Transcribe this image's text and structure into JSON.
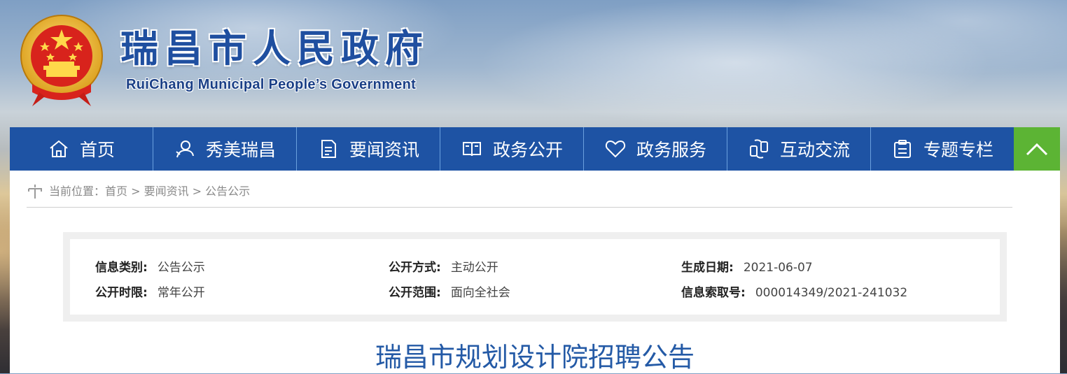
{
  "header": {
    "title": "瑞昌市人民政府",
    "subtitle": "RuiChang Municipal People’s Government"
  },
  "nav": {
    "items": [
      {
        "label": "首页",
        "icon": "home-icon"
      },
      {
        "label": "秀美瑞昌",
        "icon": "person-icon"
      },
      {
        "label": "要闻资讯",
        "icon": "document-icon"
      },
      {
        "label": "政务公开",
        "icon": "book-icon"
      },
      {
        "label": "政务服务",
        "icon": "heart-icon"
      },
      {
        "label": "互动交流",
        "icon": "exchange-icon"
      },
      {
        "label": "专题专栏",
        "icon": "clipboard-icon"
      }
    ],
    "scroll_top_icon": "chevron-up-icon"
  },
  "breadcrumb": {
    "text": "当前位置：首页 > 要闻资讯 > 公告公示"
  },
  "meta": {
    "category_label": "信息类别:",
    "category_value": "公告公示",
    "disclosure_method_label": "公开方式:",
    "disclosure_method_value": "主动公开",
    "date_label": "生成日期:",
    "date_value": "2021-06-07",
    "period_label": "公开时限:",
    "period_value": "常年公开",
    "scope_label": "公开范围:",
    "scope_value": "面向全社会",
    "index_label": "信息索取号:",
    "index_value": "000014349/2021-241032"
  },
  "article": {
    "title": "瑞昌市规划设计院招聘公告"
  },
  "colors": {
    "nav_bg": "#1e53a4",
    "scroll_top_bg": "#5cb434",
    "title_blue": "#245aa6"
  }
}
